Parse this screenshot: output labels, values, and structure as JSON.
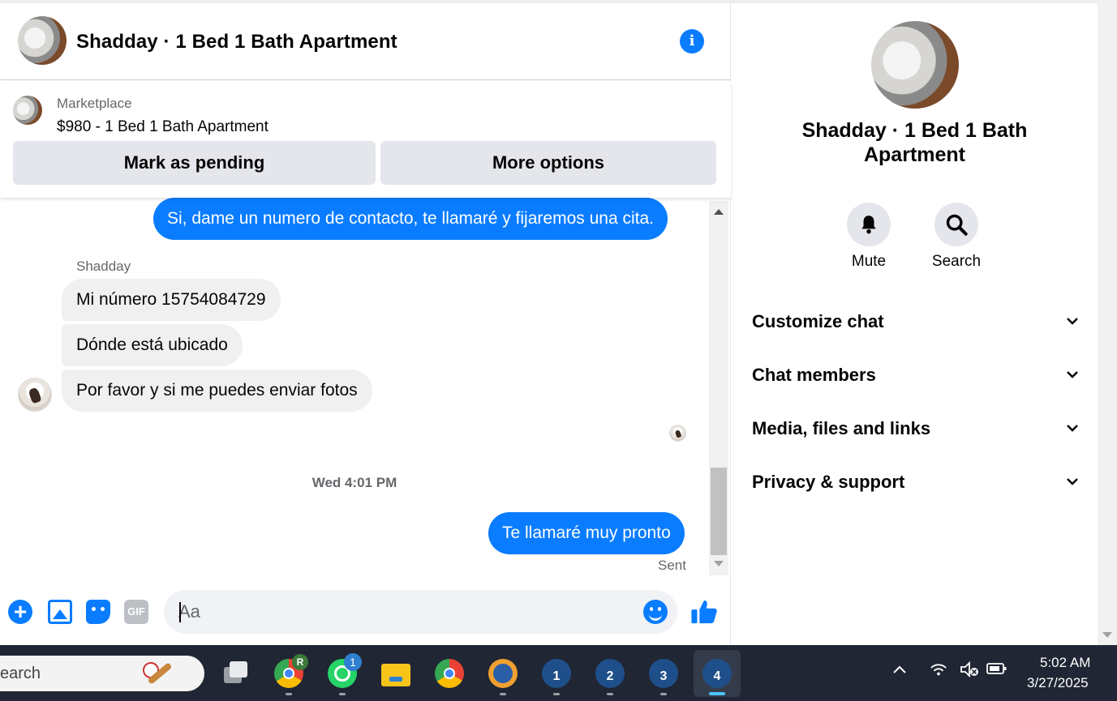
{
  "chat": {
    "title": "Shadday · 1 Bed 1 Bath Apartment",
    "info_icon": "info-icon"
  },
  "marketplace": {
    "label": "Marketplace",
    "item": "$980 - 1 Bed 1 Bath Apartment",
    "mark_pending": "Mark as pending",
    "more_options": "More options"
  },
  "messages": {
    "out_1": "Si, dame un numero de contacto, te llamaré y fijaremos una cita.",
    "sender": "Shadday",
    "in_1": "Mi número 15754084729",
    "in_2": "Dónde está ubicado",
    "in_3": "Por favor y si me puedes enviar fotos",
    "timestamp": "Wed 4:01 PM",
    "out_2": "Te llamaré muy pronto",
    "status": "Sent"
  },
  "composer": {
    "placeholder": "Aa",
    "gif": "GIF",
    "plus": "+"
  },
  "side": {
    "title": "Shadday · 1 Bed 1 Bath Apartment",
    "mute": "Mute",
    "search": "Search",
    "sections": [
      "Customize chat",
      "Chat members",
      "Media, files and links",
      "Privacy & support"
    ]
  },
  "taskbar": {
    "search_text": "earch",
    "chrome_badge": "R",
    "whatsapp_badge": "1",
    "app1": "1",
    "app2": "2",
    "app3": "3",
    "app4": "4",
    "time": "5:02 AM",
    "date": "3/27/2025"
  },
  "colors": {
    "accent": "#0a7cff",
    "incoming_bubble": "#f0f0f0",
    "button_gray": "#e4e6eb",
    "taskbar": "#202633"
  }
}
